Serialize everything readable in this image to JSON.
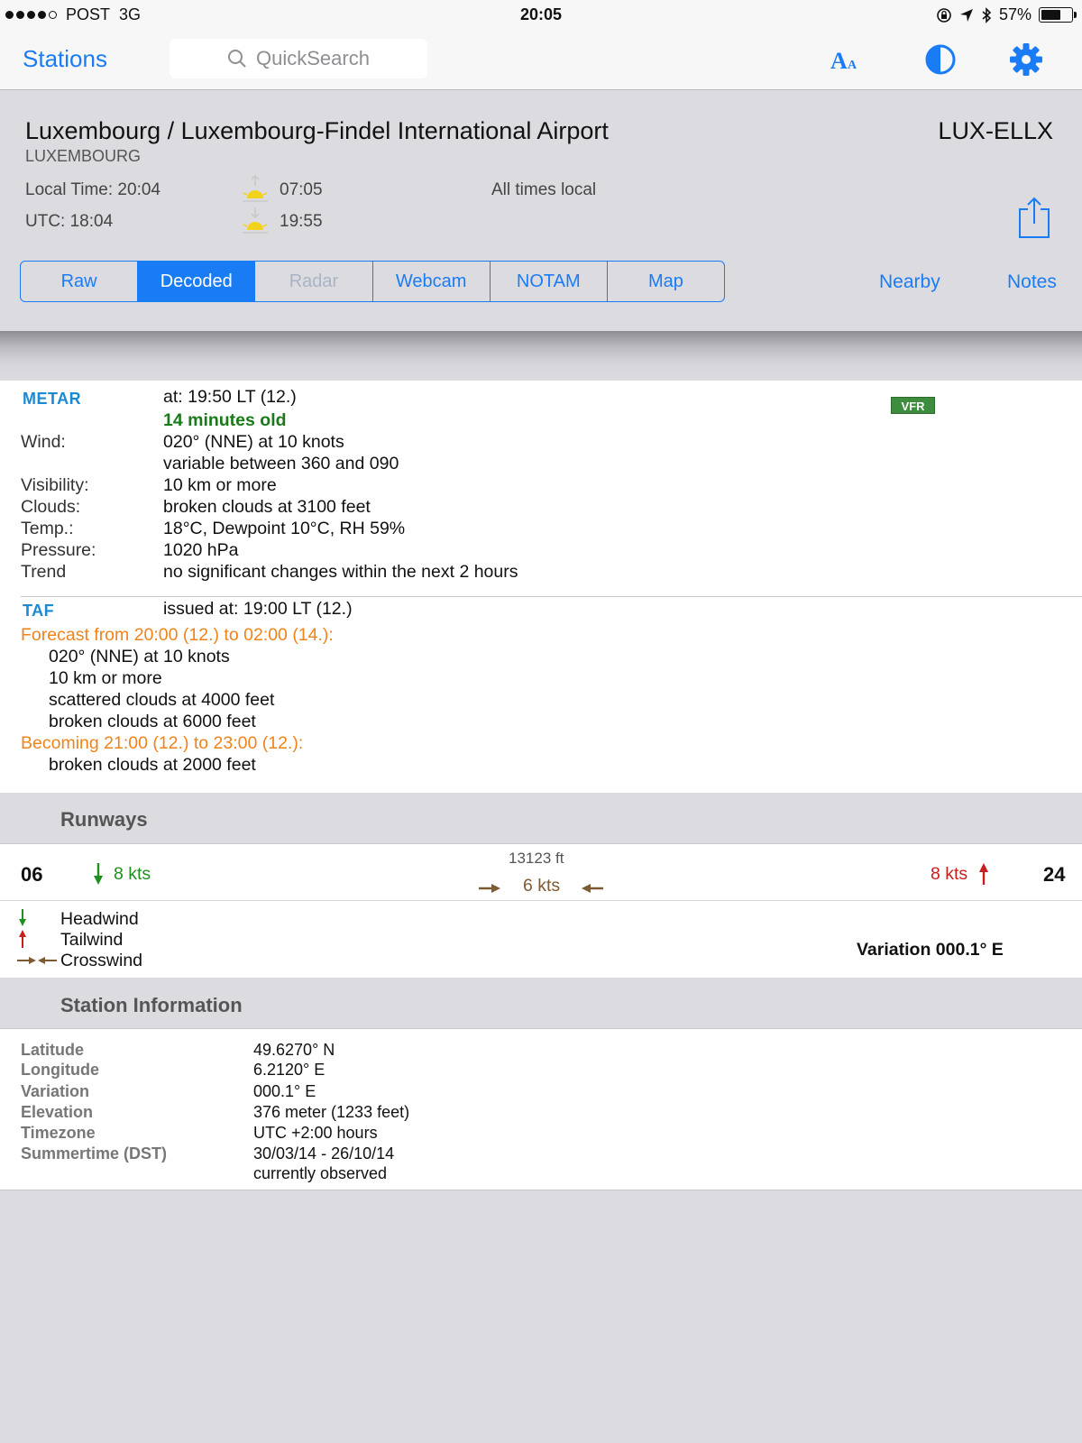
{
  "status_bar": {
    "carrier": "POST",
    "network": "3G",
    "time": "20:05",
    "battery": "57%",
    "battery_level": 0.57
  },
  "nav": {
    "back_label": "Stations",
    "search_placeholder": "QuickSearch"
  },
  "station": {
    "name": "Luxembourg / Luxembourg-Findel International Airport",
    "country": "LUXEMBOURG",
    "code": "LUX-ELLX",
    "local_time": "Local Time: 20:04",
    "utc_time": "UTC: 18:04",
    "sunrise": "07:05",
    "sunset": "19:55",
    "times_note": "All times local"
  },
  "tabs": [
    {
      "label": "Raw",
      "state": "normal"
    },
    {
      "label": "Decoded",
      "state": "active"
    },
    {
      "label": "Radar",
      "state": "disabled"
    },
    {
      "label": "Webcam",
      "state": "normal"
    },
    {
      "label": "NOTAM",
      "state": "normal"
    },
    {
      "label": "Map",
      "state": "normal"
    }
  ],
  "links": {
    "nearby": "Nearby",
    "notes": "Notes"
  },
  "metar": {
    "title": "METAR",
    "issued": "at: 19:50 LT (12.)",
    "age": "14 minutes old",
    "flight_rules": "VFR",
    "rows": [
      {
        "label": "Wind:",
        "value": "020° (NNE) at 10 knots"
      },
      {
        "label": "",
        "value": "variable between 360 and 090"
      },
      {
        "label": "Visibility:",
        "value": "10 km or more"
      },
      {
        "label": "Clouds:",
        "value": "broken clouds at 3100 feet"
      },
      {
        "label": "Temp.:",
        "value": "18°C, Dewpoint 10°C, RH 59%"
      },
      {
        "label": "Pressure:",
        "value": "1020 hPa"
      },
      {
        "label": "Trend",
        "value": "no significant changes within the next 2 hours"
      }
    ]
  },
  "taf": {
    "title": "TAF",
    "issued": "issued at: 19:00 LT (12.)",
    "forecast_header": "Forecast from 20:00 (12.) to 02:00 (14.):",
    "forecast_lines": [
      "020° (NNE) at 10 knots",
      "10 km or more",
      "scattered clouds at 4000 feet",
      "broken clouds at 6000 feet"
    ],
    "becoming_header": "Becoming 21:00 (12.) to 23:00 (12.):",
    "becoming_lines": [
      "broken clouds at 2000 feet"
    ]
  },
  "runways": {
    "title": "Runways",
    "left_id": "06",
    "left_headwind": "8 kts",
    "length": "13123 ft",
    "crosswind": "6 kts",
    "right_tailwind": "8 kts",
    "right_id": "24",
    "legend": {
      "headwind": "Headwind",
      "tailwind": "Tailwind",
      "crosswind": "Crosswind"
    },
    "variation": "Variation 000.1° E",
    "colors": {
      "headwind": "#1f8f1f",
      "tailwind": "#c81e1e",
      "crosswind": "#7e5a32"
    }
  },
  "station_info": {
    "title": "Station Information",
    "rows": [
      {
        "label": "Latitude",
        "value": "49.6270° N"
      },
      {
        "label": "Longitude",
        "value": "6.2120° E"
      },
      {
        "label": "Variation",
        "value": "000.1° E"
      },
      {
        "label": "Elevation",
        "value": "376 meter (1233 feet)"
      },
      {
        "label": "Timezone",
        "value": "UTC +2:00 hours"
      },
      {
        "label": "Summertime (DST)",
        "value": "30/03/14 - 26/10/14"
      },
      {
        "label": "",
        "value": "currently observed"
      }
    ]
  },
  "colors": {
    "accent": "#1a7cf5",
    "metar_title": "#1a8ad2",
    "forecast": "#f0831a",
    "vfr": "#3e8d3e"
  }
}
